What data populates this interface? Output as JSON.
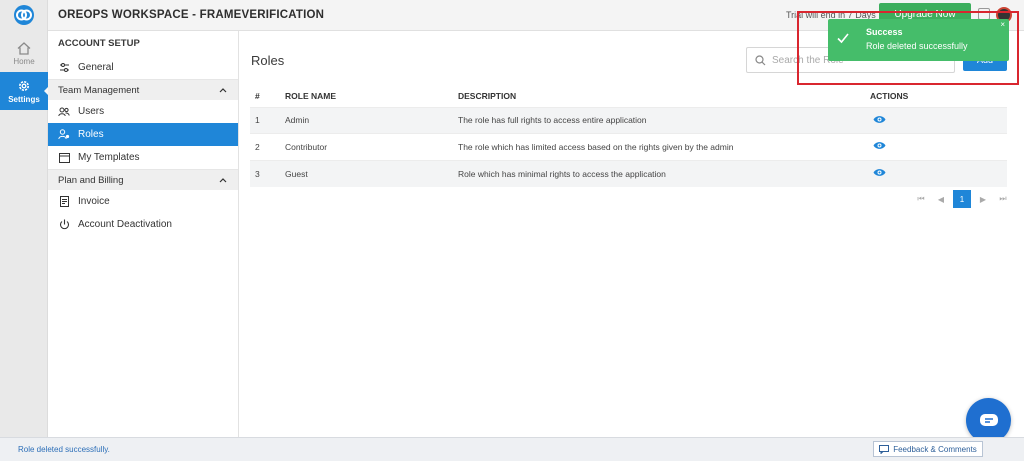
{
  "rail": {
    "items": [
      {
        "label": "Home",
        "icon": "home-icon"
      },
      {
        "label": "Settings",
        "icon": "gear-icon"
      }
    ]
  },
  "header": {
    "title": "OREOPS WORKSPACE - FRAMEVERIFICATION",
    "trial_text": "Trial will end in 7 Days",
    "upgrade_label": "Upgrade Now"
  },
  "sidebar": {
    "heading": "ACCOUNT SETUP",
    "general": "General",
    "team_group": "Team Management",
    "team_items": [
      "Users",
      "Roles",
      "My Templates"
    ],
    "billing_group": "Plan and Billing",
    "billing_items": [
      "Invoice",
      "Account Deactivation"
    ],
    "active": "Roles"
  },
  "main": {
    "title": "Roles",
    "search_placeholder": "Search the Role",
    "add_label": "Add",
    "columns": [
      "#",
      "ROLE NAME",
      "DESCRIPTION",
      "ACTIONS"
    ],
    "rows": [
      {
        "num": "1",
        "name": "Admin",
        "desc": "The role has full rights to access entire application"
      },
      {
        "num": "2",
        "name": "Contributor",
        "desc": "The role which has limited access based on the rights given by the admin"
      },
      {
        "num": "3",
        "name": "Guest",
        "desc": "Role which has minimal rights to access the application"
      }
    ],
    "pagination": {
      "first": "⏮",
      "prev": "◀",
      "current": "1",
      "next": "▶",
      "last": "⏭"
    }
  },
  "toast": {
    "title": "Success",
    "message": "Role deleted successfully",
    "close": "×"
  },
  "statusbar": {
    "message": "Role deleted successfully.",
    "feedback_label": "Feedback & Comments"
  },
  "colors": {
    "accent": "#1f86d8",
    "success": "#45bd6a",
    "highlight": "#d9262f"
  }
}
